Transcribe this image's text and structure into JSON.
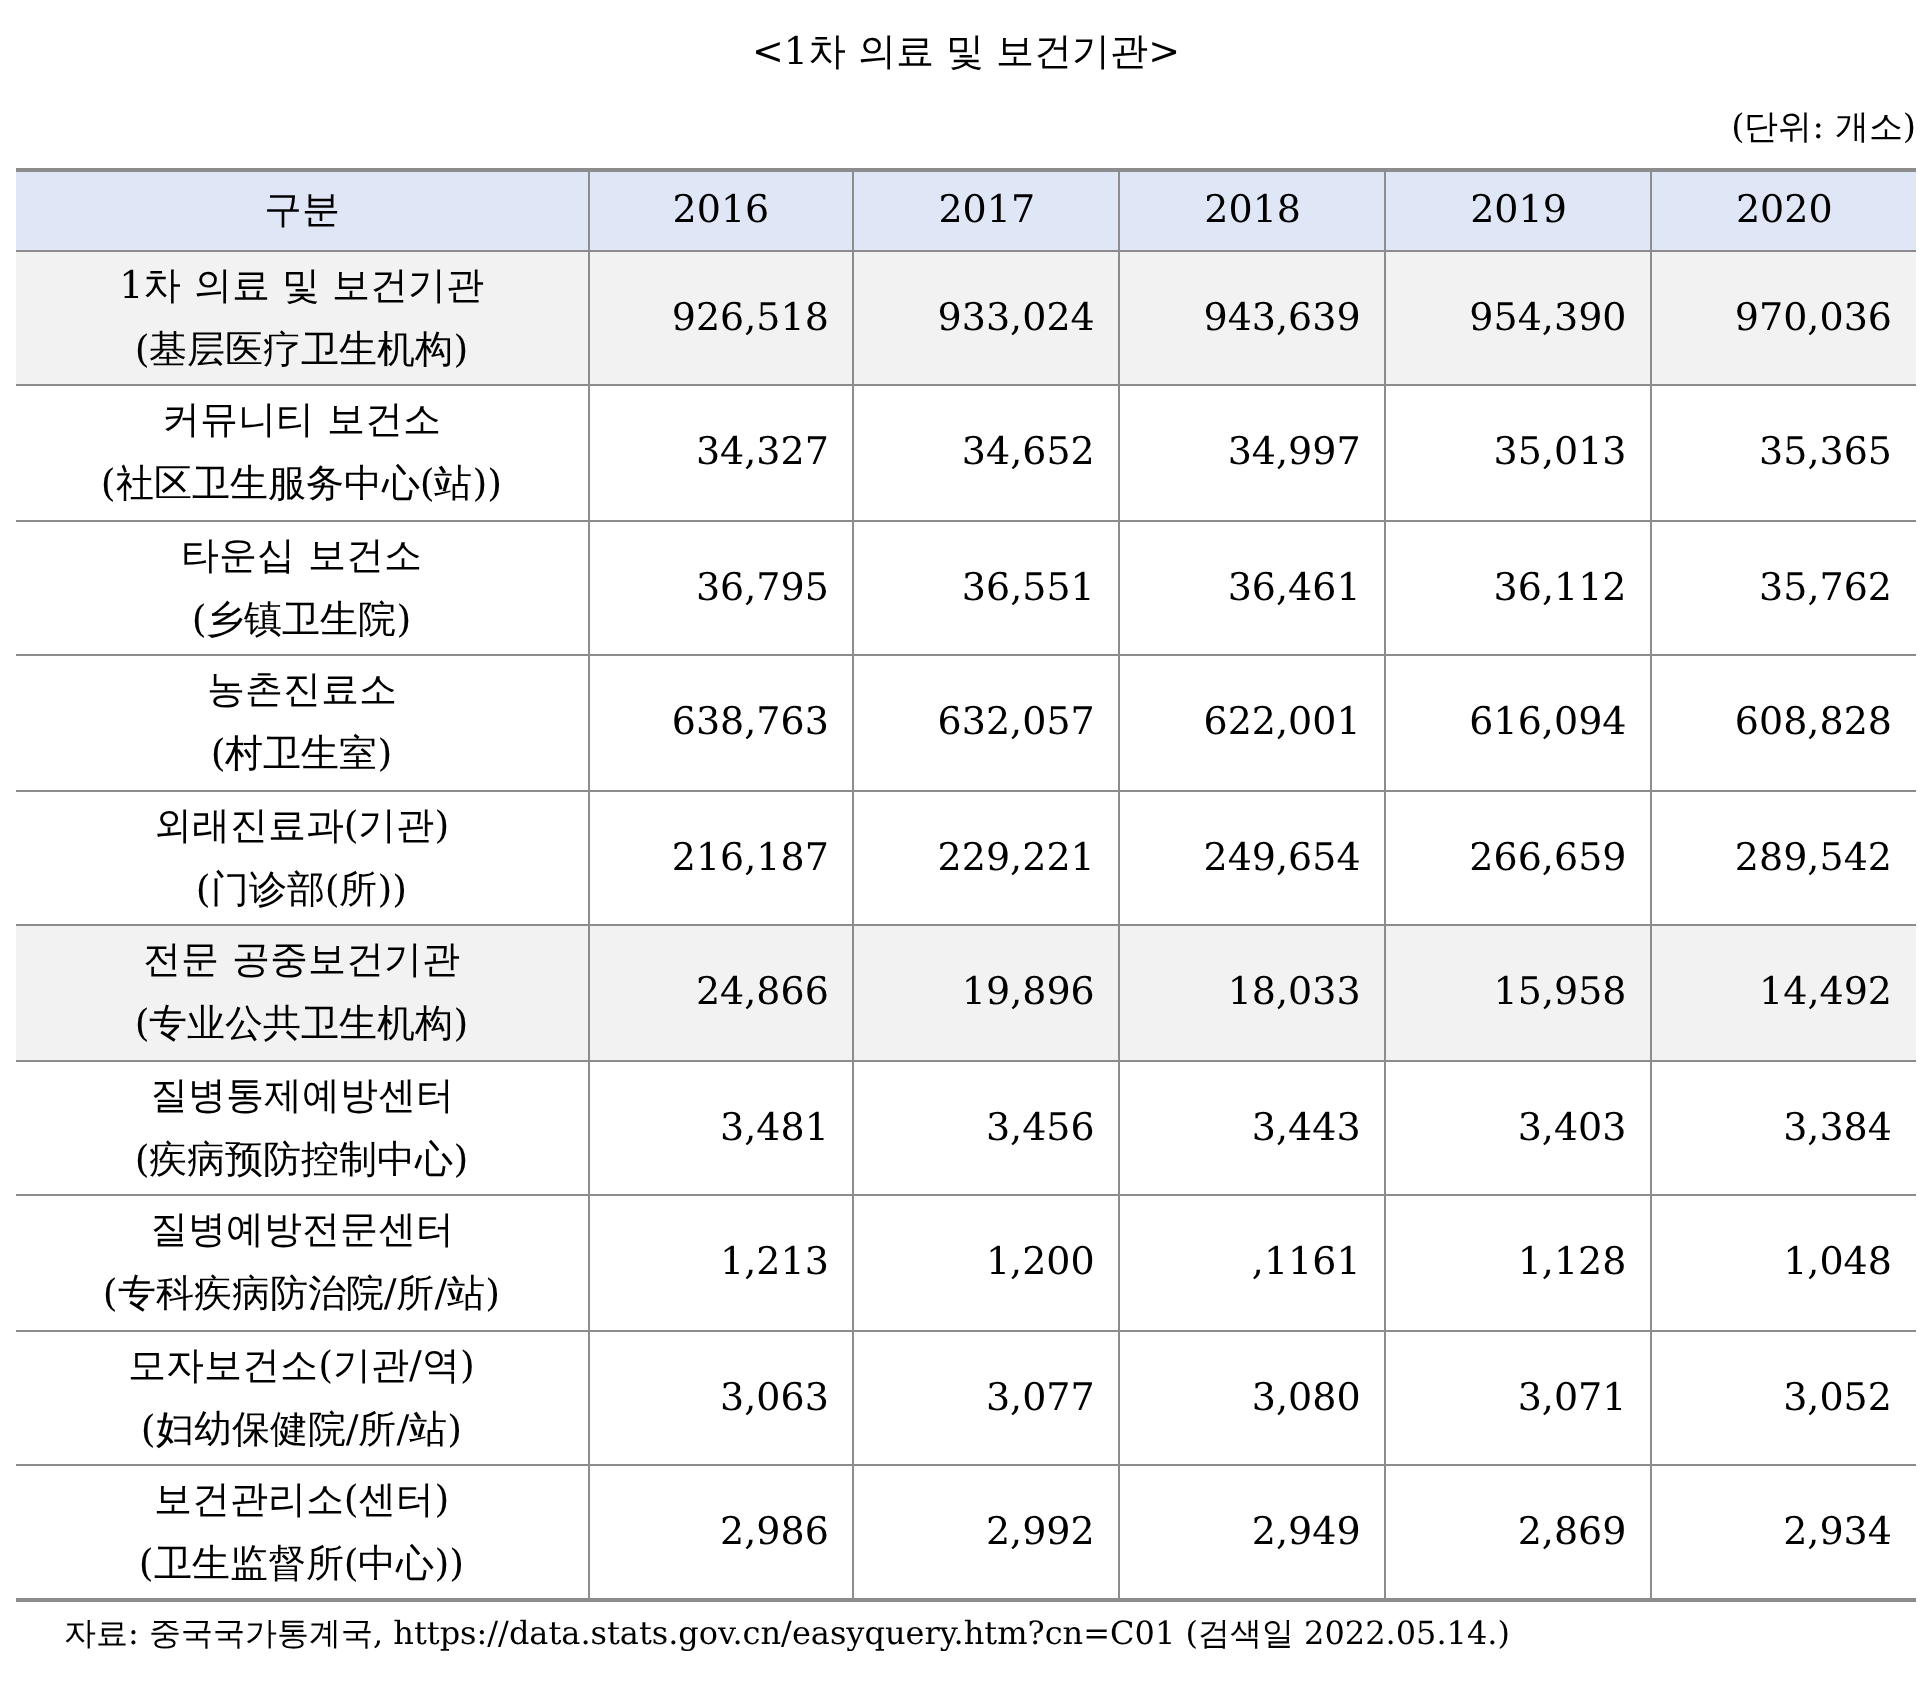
{
  "title": "<1차 의료 및 보건기관>",
  "unit": "(단위: 개소)",
  "table": {
    "columns": [
      "구분",
      "2016",
      "2017",
      "2018",
      "2019",
      "2020"
    ],
    "rows": [
      {
        "kind": "group",
        "name": "1차 의료 및 보건기관",
        "name_zh": "(基层医疗卫生机构)",
        "values": [
          "926,518",
          "933,024",
          "943,639",
          "954,390",
          "970,036"
        ]
      },
      {
        "kind": "item",
        "name": "커뮤니티 보건소",
        "name_zh": "(社区卫生服务中心(站))",
        "values": [
          "34,327",
          "34,652",
          "34,997",
          "35,013",
          "35,365"
        ]
      },
      {
        "kind": "item",
        "name": "타운십 보건소",
        "name_zh": "(乡镇卫生院)",
        "values": [
          "36,795",
          "36,551",
          "36,461",
          "36,112",
          "35,762"
        ]
      },
      {
        "kind": "item",
        "name": "농촌진료소",
        "name_zh": "(村卫生室)",
        "values": [
          "638,763",
          "632,057",
          "622,001",
          "616,094",
          "608,828"
        ]
      },
      {
        "kind": "item",
        "name": "외래진료과(기관)",
        "name_zh": "(门诊部(所))",
        "values": [
          "216,187",
          "229,221",
          "249,654",
          "266,659",
          "289,542"
        ]
      },
      {
        "kind": "group",
        "name": "전문 공중보건기관",
        "name_zh": "(专业公共卫生机构)",
        "values": [
          "24,866",
          "19,896",
          "18,033",
          "15,958",
          "14,492"
        ]
      },
      {
        "kind": "item",
        "name": "질병통제예방센터",
        "name_zh": "(疾病预防控制中心)",
        "values": [
          "3,481",
          "3,456",
          "3,443",
          "3,403",
          "3,384"
        ]
      },
      {
        "kind": "item",
        "name": "질병예방전문센터",
        "name_zh": "(专科疾病防治院/所/站)",
        "values": [
          "1,213",
          "1,200",
          ",1161",
          "1,128",
          "1,048"
        ]
      },
      {
        "kind": "item",
        "name": "모자보건소(기관/역)",
        "name_zh": "(妇幼保健院/所/站)",
        "values": [
          "3,063",
          "3,077",
          "3,080",
          "3,071",
          "3,052"
        ]
      },
      {
        "kind": "item",
        "name": "보건관리소(센터)",
        "name_zh": "(卫生监督所(中心))",
        "values": [
          "2,986",
          "2,992",
          "2,949",
          "2,869",
          "2,934"
        ]
      }
    ]
  },
  "source": "자료: 중국국가통계국, https://data.stats.gov.cn/easyquery.htm?cn=C01 (검색일 2022.05.14.)"
}
